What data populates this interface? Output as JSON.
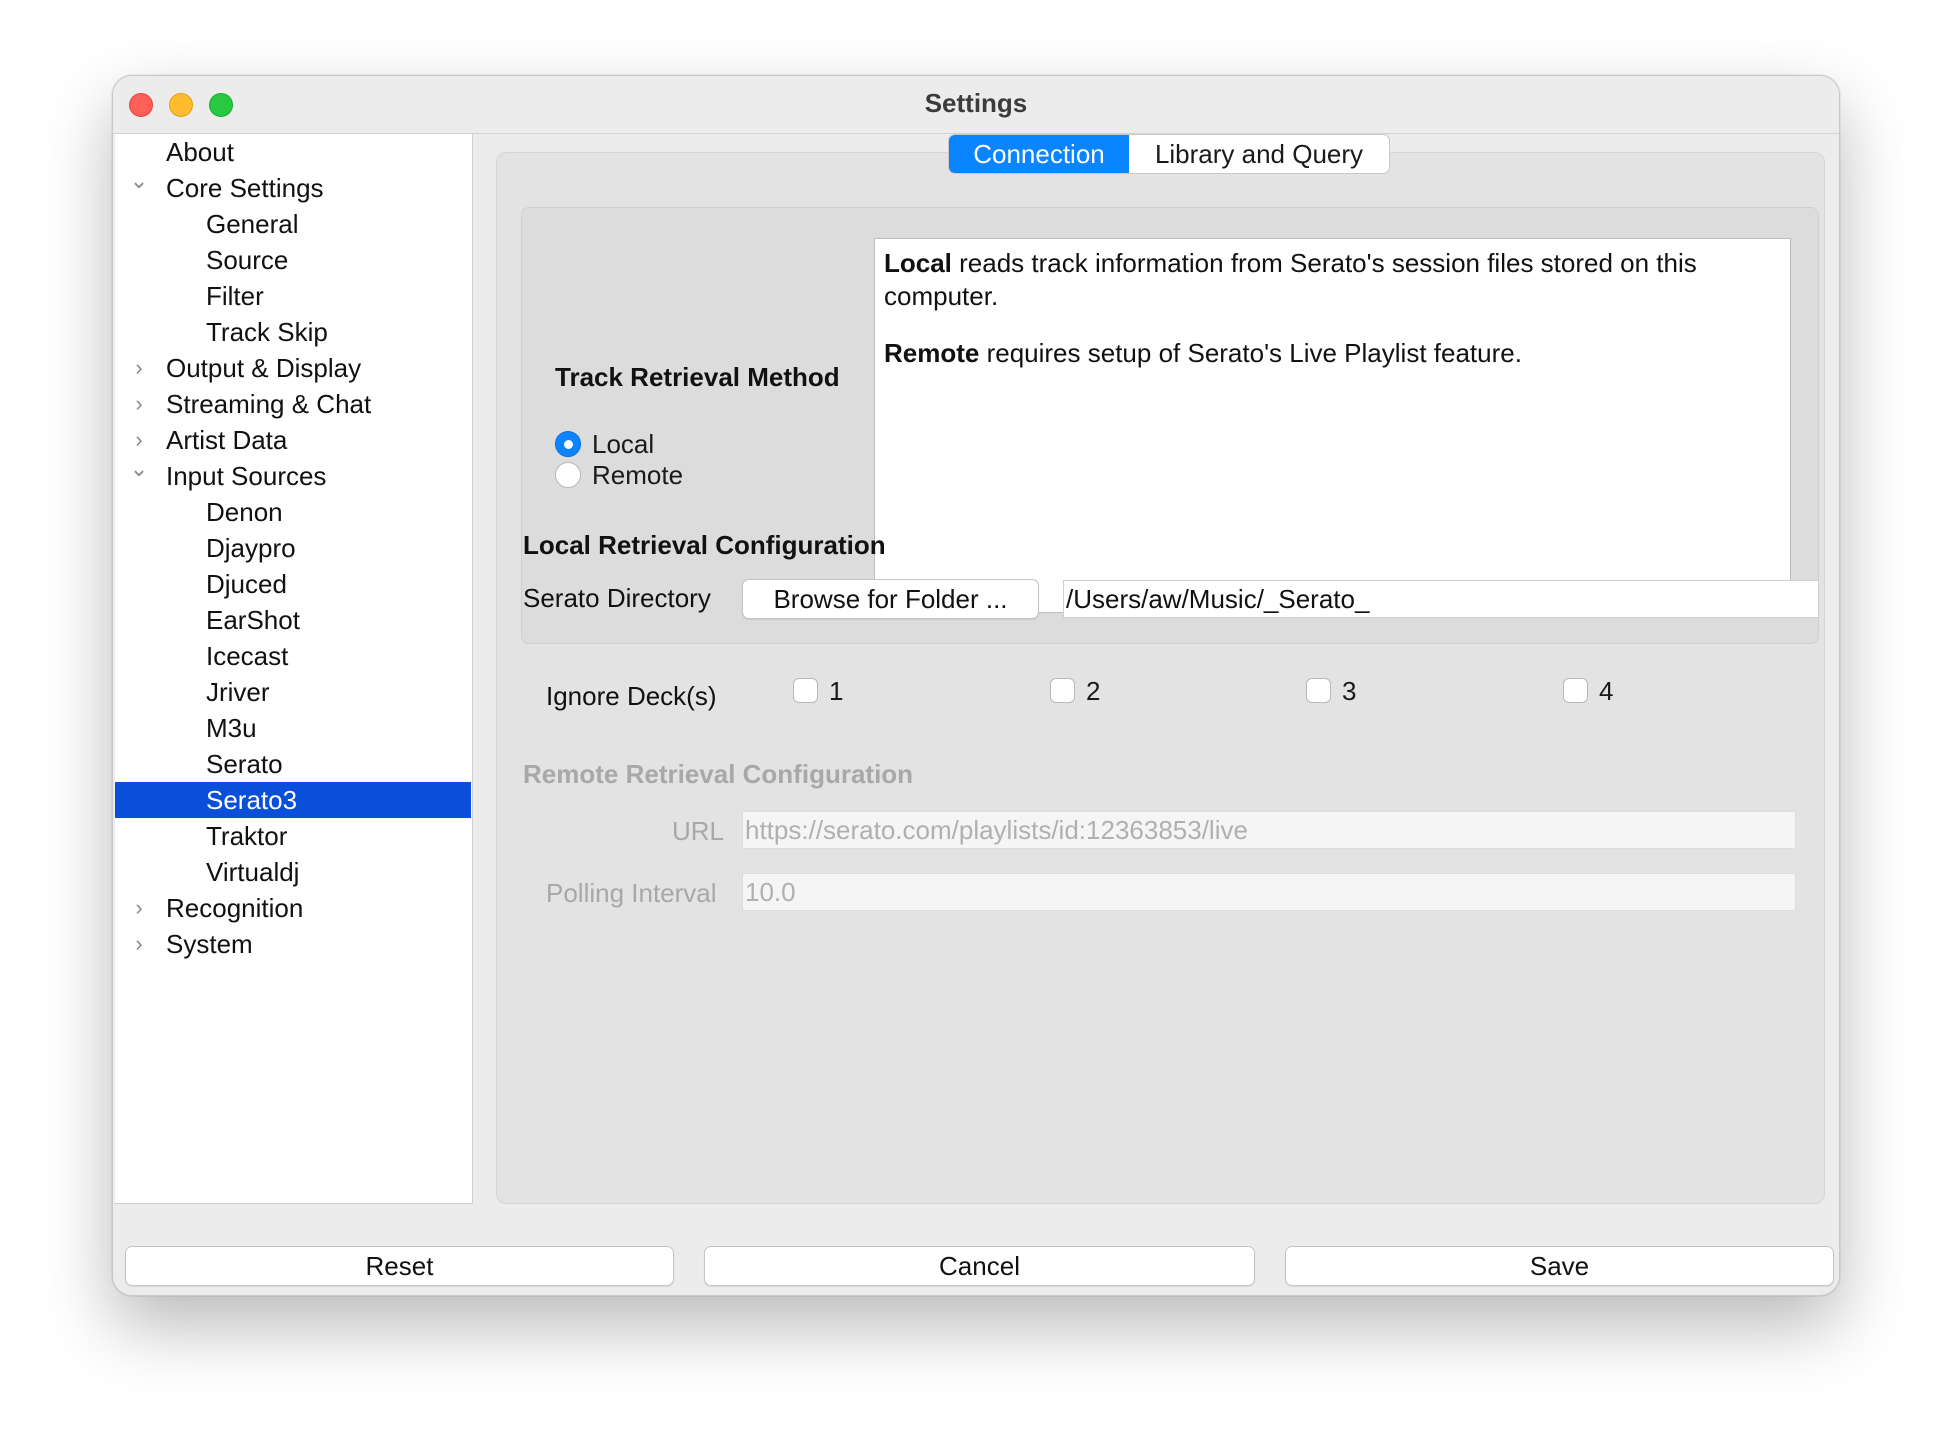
{
  "window": {
    "title": "Settings"
  },
  "sidebar": {
    "items": [
      {
        "label": "About",
        "level": 0,
        "chevron": ""
      },
      {
        "label": "Core Settings",
        "level": 0,
        "chevron": "expanded"
      },
      {
        "label": "General",
        "level": 1,
        "chevron": ""
      },
      {
        "label": "Source",
        "level": 1,
        "chevron": ""
      },
      {
        "label": "Filter",
        "level": 1,
        "chevron": ""
      },
      {
        "label": "Track Skip",
        "level": 1,
        "chevron": ""
      },
      {
        "label": "Output & Display",
        "level": 0,
        "chevron": "collapsed"
      },
      {
        "label": "Streaming & Chat",
        "level": 0,
        "chevron": "collapsed"
      },
      {
        "label": "Artist Data",
        "level": 0,
        "chevron": "collapsed"
      },
      {
        "label": "Input Sources",
        "level": 0,
        "chevron": "expanded"
      },
      {
        "label": "Denon",
        "level": 1,
        "chevron": ""
      },
      {
        "label": "Djaypro",
        "level": 1,
        "chevron": ""
      },
      {
        "label": "Djuced",
        "level": 1,
        "chevron": ""
      },
      {
        "label": "EarShot",
        "level": 1,
        "chevron": ""
      },
      {
        "label": "Icecast",
        "level": 1,
        "chevron": ""
      },
      {
        "label": "Jriver",
        "level": 1,
        "chevron": ""
      },
      {
        "label": "M3u",
        "level": 1,
        "chevron": ""
      },
      {
        "label": "Serato",
        "level": 1,
        "chevron": ""
      },
      {
        "label": "Serato3",
        "level": 1,
        "chevron": "",
        "selected": true
      },
      {
        "label": "Traktor",
        "level": 1,
        "chevron": ""
      },
      {
        "label": "Virtualdj",
        "level": 1,
        "chevron": ""
      },
      {
        "label": "Recognition",
        "level": 0,
        "chevron": "collapsed"
      },
      {
        "label": "System",
        "level": 0,
        "chevron": "collapsed"
      }
    ]
  },
  "tabs": [
    {
      "label": "Connection",
      "active": true
    },
    {
      "label": "Library and Query",
      "active": false
    }
  ],
  "retrieval": {
    "label": "Track Retrieval Method",
    "options": [
      {
        "label": "Local",
        "selected": true
      },
      {
        "label": "Remote",
        "selected": false
      }
    ],
    "info": {
      "local_bold": "Local",
      "local_text": " reads track information from Serato's session files stored on this computer.",
      "remote_bold": "Remote",
      "remote_text": " requires setup of Serato's Live Playlist feature."
    }
  },
  "local_config": {
    "title": "Local Retrieval Configuration",
    "dir_label": "Serato Directory",
    "browse_label": "Browse for Folder ...",
    "dir_value": "/Users/aw/Music/_Serato_",
    "ignore_label": "Ignore Deck(s)",
    "decks": [
      {
        "label": "1",
        "checked": false
      },
      {
        "label": "2",
        "checked": false
      },
      {
        "label": "3",
        "checked": false
      },
      {
        "label": "4",
        "checked": false
      }
    ]
  },
  "remote_config": {
    "title": "Remote Retrieval Configuration",
    "url_label": "URL",
    "url_placeholder": "https://serato.com/playlists/id:12363853/live",
    "polling_label": "Polling Interval",
    "polling_value": "10.0"
  },
  "footer": {
    "reset": "Reset",
    "cancel": "Cancel",
    "save": "Save"
  },
  "colors": {
    "accent": "#0b84ff",
    "selection": "#0a4fd9"
  }
}
